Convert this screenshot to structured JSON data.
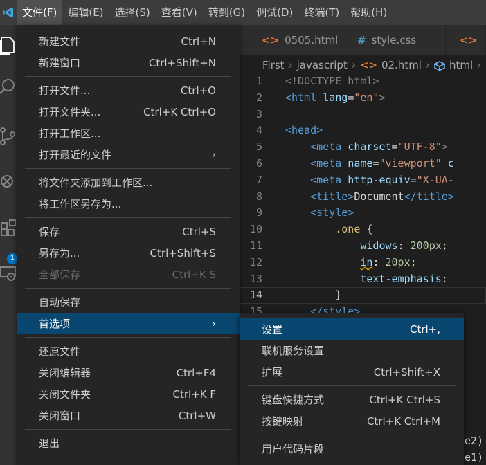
{
  "menubar": {
    "items": [
      "文件(F)",
      "编辑(E)",
      "选择(S)",
      "查看(V)",
      "转到(G)",
      "调试(D)",
      "终端(T)",
      "帮助(H)"
    ]
  },
  "activity": {
    "badge": "1"
  },
  "tabs": [
    {
      "icon": "<>",
      "label": "0505.html"
    },
    {
      "icon": "#",
      "label": "style.css"
    },
    {
      "icon": "<>",
      "label": ""
    }
  ],
  "breadcrumb": [
    "First",
    "javascript",
    "02.html",
    "html"
  ],
  "code_lines": [
    {
      "n": "1"
    },
    {
      "n": "2"
    },
    {
      "n": "3"
    },
    {
      "n": "4"
    },
    {
      "n": "5"
    },
    {
      "n": "6"
    },
    {
      "n": "7"
    },
    {
      "n": "8"
    },
    {
      "n": "9"
    },
    {
      "n": "10"
    },
    {
      "n": "11"
    },
    {
      "n": "12"
    },
    {
      "n": "13"
    },
    {
      "n": "14"
    },
    {
      "n": "15"
    }
  ],
  "code_text": {
    "doctype": "<!DOCTYPE html>",
    "html_open": "<html",
    "lang_attr": " lang",
    "lang_val": "\"en\"",
    "head": "<head>",
    "meta": "<meta",
    "charset": " charset",
    "charset_val": "\"UTF-8\"",
    "name": " name",
    "viewport": "\"viewport\"",
    "viewport_tail": " c",
    "httpequiv": " http-equiv",
    "xua": "\"X-UA-",
    "title_open": "<title>",
    "title_text": "Document",
    "title_close": "</title>",
    "style_open": "<style>",
    "selector": ".one",
    "brace_open": " {",
    "prop1": "widows",
    "val1": " 200px",
    "prop2": "in",
    "val2": " 20px",
    "prop3": "text-emphasis",
    "brace_close": "}",
    "style_close": "</style>",
    "tail1": "le2)",
    "tail2": "le1)"
  },
  "file_menu": {
    "groups": [
      [
        {
          "label": "新建文件",
          "kb": "Ctrl+N"
        },
        {
          "label": "新建窗口",
          "kb": "Ctrl+Shift+N"
        }
      ],
      [
        {
          "label": "打开文件...",
          "kb": "Ctrl+O"
        },
        {
          "label": "打开文件夹...",
          "kb": "Ctrl+K Ctrl+O"
        },
        {
          "label": "打开工作区...",
          "kb": ""
        },
        {
          "label": "打开最近的文件",
          "kb": ""
        }
      ],
      [
        {
          "label": "将文件夹添加到工作区...",
          "kb": ""
        },
        {
          "label": "将工作区另存为...",
          "kb": ""
        }
      ],
      [
        {
          "label": "保存",
          "kb": "Ctrl+S"
        },
        {
          "label": "另存为...",
          "kb": "Ctrl+Shift+S"
        },
        {
          "label": "全部保存",
          "kb": "Ctrl+K S"
        }
      ],
      [
        {
          "label": "自动保存",
          "kb": ""
        },
        {
          "label": "首选项",
          "kb": ""
        }
      ],
      [
        {
          "label": "还原文件",
          "kb": ""
        },
        {
          "label": "关闭编辑器",
          "kb": "Ctrl+F4"
        },
        {
          "label": "关闭文件夹",
          "kb": "Ctrl+K F"
        },
        {
          "label": "关闭窗口",
          "kb": "Ctrl+W"
        }
      ],
      [
        {
          "label": "退出",
          "kb": ""
        }
      ]
    ]
  },
  "pref_menu": {
    "items": [
      {
        "label": "设置",
        "kb": "Ctrl+,"
      },
      {
        "label": "联机服务设置",
        "kb": ""
      },
      {
        "label": "扩展",
        "kb": "Ctrl+Shift+X"
      },
      {
        "label": "键盘快捷方式",
        "kb": "Ctrl+K Ctrl+S"
      },
      {
        "label": "按键映射",
        "kb": "Ctrl+K Ctrl+M"
      },
      {
        "label": "用户代码片段",
        "kb": ""
      }
    ]
  }
}
